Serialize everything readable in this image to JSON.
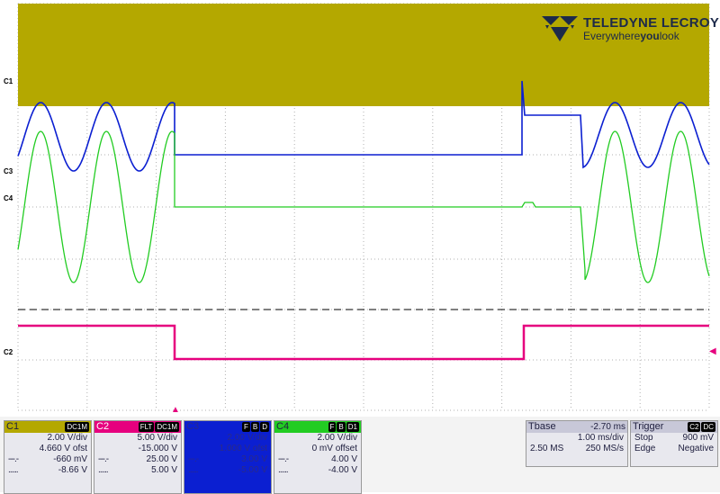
{
  "logo": {
    "brand": "TELEDYNE LECROY",
    "tagline": "Everywhereyoulook",
    "tagline_bold_part": "you"
  },
  "channels": {
    "c1": {
      "label": "C1",
      "color": "#b4a800"
    },
    "c2": {
      "label": "C2",
      "color": "#e6007e"
    },
    "c3": {
      "label": "C3",
      "color": "#0b1fd1"
    },
    "c4": {
      "label": "C4",
      "color": "#22cc22"
    }
  },
  "trigger_marker": "▲",
  "right_marker": "◀",
  "panels": {
    "c1": {
      "name": "C1",
      "tags": [
        "DC1M"
      ],
      "vdiv": "2.00 V/div",
      "offset": "4.660 V ofst",
      "cursor1": "-660 mV",
      "cursor2": "-8.66 V",
      "cursor1_prefix": "---.-",
      "cursor2_prefix": "......"
    },
    "c2": {
      "name": "C2",
      "tags": [
        "FLT",
        "DC1M"
      ],
      "vdiv": "5.00 V/div",
      "offset": "-15.000 V",
      "cursor1": "25.00 V",
      "cursor2": "5.00 V",
      "cursor1_prefix": "---.-",
      "cursor2_prefix": "......"
    },
    "c3": {
      "name": "C3",
      "tags": [
        "F",
        "B",
        "D"
      ],
      "vdiv": "2.00 V/div",
      "offset": "1.000 V ofst",
      "cursor1": "3.00 V",
      "cursor2": "-5.00 V",
      "cursor1_prefix": "---.-",
      "cursor2_prefix": "......"
    },
    "c4": {
      "name": "C4",
      "tags": [
        "F",
        "B",
        "D1"
      ],
      "vdiv": "2.00 V/div",
      "offset": "0 mV offset",
      "cursor1": "4.00 V",
      "cursor2": "-4.00 V",
      "cursor1_prefix": "---.-",
      "cursor2_prefix": "......"
    },
    "tbase": {
      "name": "Tbase",
      "delay": "-2.70 ms",
      "tdiv": "1.00 ms/div",
      "samples": "2.50 MS",
      "rate": "250 MS/s"
    },
    "trigger": {
      "name": "Trigger",
      "tags": [
        "C2",
        "DC"
      ],
      "mode": "Stop",
      "level": "900 mV",
      "type": "Edge",
      "slope": "Negative"
    }
  }
}
